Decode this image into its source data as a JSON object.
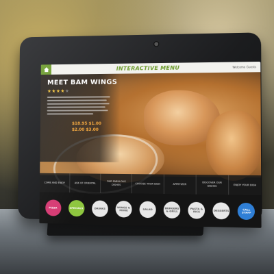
{
  "screen": {
    "header": {
      "title": "INTERACTIVE MENU",
      "right_text": "Welcome Guests"
    },
    "dish": {
      "name": "MEET BAM WINGS",
      "rating": 4,
      "rating_max": 5,
      "price_line_1": "$18.95 $1.00",
      "price_line_2": "$2.00 $3.00"
    },
    "menu_items": [
      {
        "label": "Come and enjoy"
      },
      {
        "label": "Ask of oriental"
      },
      {
        "label": "Our fabulous dishes"
      },
      {
        "label": "Choose your dish"
      },
      {
        "label": "Appetizer"
      },
      {
        "label": "Discover our dishes"
      },
      {
        "label": "Enjoy your dish"
      }
    ],
    "circle_buttons": [
      {
        "label": "Pizza",
        "bg": "#d63a73",
        "fg": "#ffffff"
      },
      {
        "label": "Specials",
        "bg": "#8ec63f",
        "fg": "#ffffff"
      },
      {
        "label": "Drinks",
        "bg": "#e8e8e8",
        "fg": "#555555"
      },
      {
        "label": "Wings & more",
        "bg": "#e8e8e8",
        "fg": "#555555"
      },
      {
        "label": "Salad",
        "bg": "#e8e8e8",
        "fg": "#555555"
      },
      {
        "label": "Burgers & grill",
        "bg": "#e8e8e8",
        "fg": "#555555"
      },
      {
        "label": "Pasta & rice",
        "bg": "#e8e8e8",
        "fg": "#555555"
      },
      {
        "label": "Desserts",
        "bg": "#e8e8e8",
        "fg": "#555555"
      },
      {
        "label": "Call staff",
        "bg": "#2f7fd6",
        "fg": "#ffffff"
      }
    ],
    "accent_color": "#6a9a2a"
  }
}
